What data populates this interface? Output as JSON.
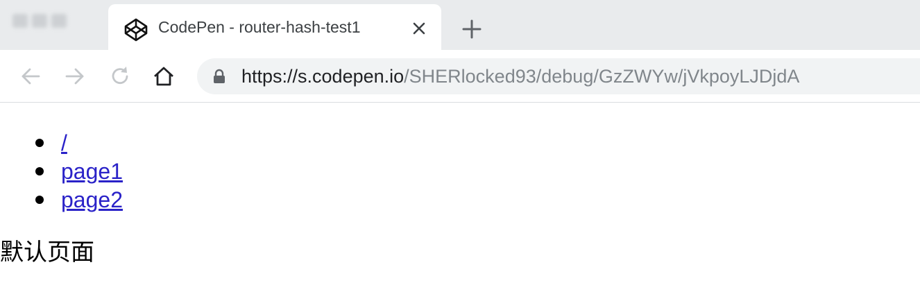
{
  "browser": {
    "active_tab": {
      "title": "CodePen - router-hash-test1",
      "favicon": "codepen-icon"
    },
    "address_bar": {
      "host": "https://s.codepen.io",
      "path": "/SHERlocked93/debug/GzZWYw/jVkpoyLJDjdA",
      "secure": true
    },
    "nav_icons": [
      "back-arrow-icon",
      "forward-arrow-icon",
      "reload-icon",
      "home-icon"
    ]
  },
  "page": {
    "links": [
      {
        "label": "/"
      },
      {
        "label": "page1"
      },
      {
        "label": "page2"
      }
    ],
    "default_text": "默认页面"
  },
  "colors": {
    "link": "#2a22c8",
    "tab_strip": "#e9ebed",
    "omnibox": "#f1f3f4",
    "url_path": "#80868b"
  }
}
